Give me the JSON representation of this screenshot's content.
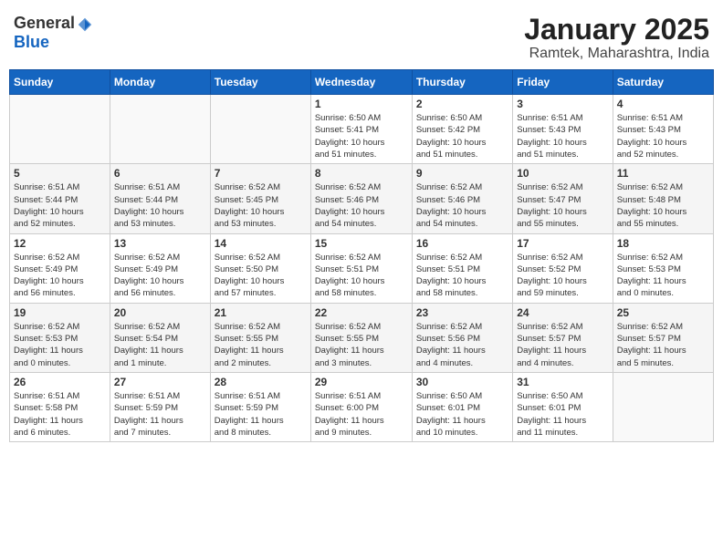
{
  "logo": {
    "general": "General",
    "blue": "Blue"
  },
  "title": "January 2025",
  "location": "Ramtek, Maharashtra, India",
  "weekdays": [
    "Sunday",
    "Monday",
    "Tuesday",
    "Wednesday",
    "Thursday",
    "Friday",
    "Saturday"
  ],
  "weeks": [
    [
      {
        "day": "",
        "info": ""
      },
      {
        "day": "",
        "info": ""
      },
      {
        "day": "",
        "info": ""
      },
      {
        "day": "1",
        "info": "Sunrise: 6:50 AM\nSunset: 5:41 PM\nDaylight: 10 hours\nand 51 minutes."
      },
      {
        "day": "2",
        "info": "Sunrise: 6:50 AM\nSunset: 5:42 PM\nDaylight: 10 hours\nand 51 minutes."
      },
      {
        "day": "3",
        "info": "Sunrise: 6:51 AM\nSunset: 5:43 PM\nDaylight: 10 hours\nand 51 minutes."
      },
      {
        "day": "4",
        "info": "Sunrise: 6:51 AM\nSunset: 5:43 PM\nDaylight: 10 hours\nand 52 minutes."
      }
    ],
    [
      {
        "day": "5",
        "info": "Sunrise: 6:51 AM\nSunset: 5:44 PM\nDaylight: 10 hours\nand 52 minutes."
      },
      {
        "day": "6",
        "info": "Sunrise: 6:51 AM\nSunset: 5:44 PM\nDaylight: 10 hours\nand 53 minutes."
      },
      {
        "day": "7",
        "info": "Sunrise: 6:52 AM\nSunset: 5:45 PM\nDaylight: 10 hours\nand 53 minutes."
      },
      {
        "day": "8",
        "info": "Sunrise: 6:52 AM\nSunset: 5:46 PM\nDaylight: 10 hours\nand 54 minutes."
      },
      {
        "day": "9",
        "info": "Sunrise: 6:52 AM\nSunset: 5:46 PM\nDaylight: 10 hours\nand 54 minutes."
      },
      {
        "day": "10",
        "info": "Sunrise: 6:52 AM\nSunset: 5:47 PM\nDaylight: 10 hours\nand 55 minutes."
      },
      {
        "day": "11",
        "info": "Sunrise: 6:52 AM\nSunset: 5:48 PM\nDaylight: 10 hours\nand 55 minutes."
      }
    ],
    [
      {
        "day": "12",
        "info": "Sunrise: 6:52 AM\nSunset: 5:49 PM\nDaylight: 10 hours\nand 56 minutes."
      },
      {
        "day": "13",
        "info": "Sunrise: 6:52 AM\nSunset: 5:49 PM\nDaylight: 10 hours\nand 56 minutes."
      },
      {
        "day": "14",
        "info": "Sunrise: 6:52 AM\nSunset: 5:50 PM\nDaylight: 10 hours\nand 57 minutes."
      },
      {
        "day": "15",
        "info": "Sunrise: 6:52 AM\nSunset: 5:51 PM\nDaylight: 10 hours\nand 58 minutes."
      },
      {
        "day": "16",
        "info": "Sunrise: 6:52 AM\nSunset: 5:51 PM\nDaylight: 10 hours\nand 58 minutes."
      },
      {
        "day": "17",
        "info": "Sunrise: 6:52 AM\nSunset: 5:52 PM\nDaylight: 10 hours\nand 59 minutes."
      },
      {
        "day": "18",
        "info": "Sunrise: 6:52 AM\nSunset: 5:53 PM\nDaylight: 11 hours\nand 0 minutes."
      }
    ],
    [
      {
        "day": "19",
        "info": "Sunrise: 6:52 AM\nSunset: 5:53 PM\nDaylight: 11 hours\nand 0 minutes."
      },
      {
        "day": "20",
        "info": "Sunrise: 6:52 AM\nSunset: 5:54 PM\nDaylight: 11 hours\nand 1 minute."
      },
      {
        "day": "21",
        "info": "Sunrise: 6:52 AM\nSunset: 5:55 PM\nDaylight: 11 hours\nand 2 minutes."
      },
      {
        "day": "22",
        "info": "Sunrise: 6:52 AM\nSunset: 5:55 PM\nDaylight: 11 hours\nand 3 minutes."
      },
      {
        "day": "23",
        "info": "Sunrise: 6:52 AM\nSunset: 5:56 PM\nDaylight: 11 hours\nand 4 minutes."
      },
      {
        "day": "24",
        "info": "Sunrise: 6:52 AM\nSunset: 5:57 PM\nDaylight: 11 hours\nand 4 minutes."
      },
      {
        "day": "25",
        "info": "Sunrise: 6:52 AM\nSunset: 5:57 PM\nDaylight: 11 hours\nand 5 minutes."
      }
    ],
    [
      {
        "day": "26",
        "info": "Sunrise: 6:51 AM\nSunset: 5:58 PM\nDaylight: 11 hours\nand 6 minutes."
      },
      {
        "day": "27",
        "info": "Sunrise: 6:51 AM\nSunset: 5:59 PM\nDaylight: 11 hours\nand 7 minutes."
      },
      {
        "day": "28",
        "info": "Sunrise: 6:51 AM\nSunset: 5:59 PM\nDaylight: 11 hours\nand 8 minutes."
      },
      {
        "day": "29",
        "info": "Sunrise: 6:51 AM\nSunset: 6:00 PM\nDaylight: 11 hours\nand 9 minutes."
      },
      {
        "day": "30",
        "info": "Sunrise: 6:50 AM\nSunset: 6:01 PM\nDaylight: 11 hours\nand 10 minutes."
      },
      {
        "day": "31",
        "info": "Sunrise: 6:50 AM\nSunset: 6:01 PM\nDaylight: 11 hours\nand 11 minutes."
      },
      {
        "day": "",
        "info": ""
      }
    ]
  ]
}
